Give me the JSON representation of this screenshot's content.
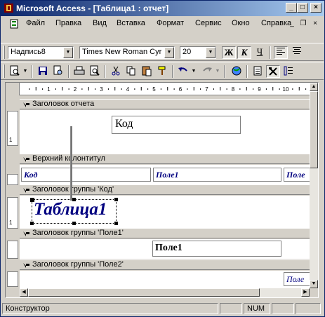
{
  "window": {
    "title": "Microsoft Access - [Таблица1 : отчет]",
    "controls": [
      "_",
      "□",
      "×"
    ],
    "doc_controls": [
      "_",
      "❐",
      "×"
    ]
  },
  "menu": [
    {
      "label": "Файл"
    },
    {
      "label": "Правка"
    },
    {
      "label": "Вид"
    },
    {
      "label": "Вставка"
    },
    {
      "label": "Формат"
    },
    {
      "label": "Сервис"
    },
    {
      "label": "Окно"
    },
    {
      "label": "Справка"
    }
  ],
  "format_toolbar": {
    "object_combo": "Надпись8",
    "font_combo": "Times New Roman Cyr",
    "size_combo": "20",
    "bold": "Ж",
    "italic": "К",
    "underline": "Ч"
  },
  "ruler": {
    "marks": [
      "1",
      "2",
      "3",
      "4",
      "5",
      "6",
      "7",
      "8",
      "9",
      "10",
      "11"
    ],
    "vertical_marks": [
      "1",
      "1"
    ]
  },
  "report": {
    "bands": {
      "report_header": "Заголовок отчета",
      "page_header": "Верхний колонтитул",
      "group_kod": "Заголовок группы 'Код'",
      "group_pole1": "Заголовок группы 'Поле1'",
      "group_pole2": "Заголовок группы 'Поле2'"
    },
    "controls": {
      "kod_box": "Код",
      "page_header_labels": [
        "Код",
        "Поле1",
        "Поле"
      ],
      "title_label": "Таблица1",
      "pole1_box": "Поле1",
      "pole2_box": "Поле"
    }
  },
  "status": {
    "mode": "Конструктор",
    "num": "NUM"
  },
  "colors": {
    "title_gradient_start": "#0a246a",
    "title_gradient_end": "#a6caf0",
    "label_text": "#000080",
    "chrome": "#d4d0c8"
  }
}
